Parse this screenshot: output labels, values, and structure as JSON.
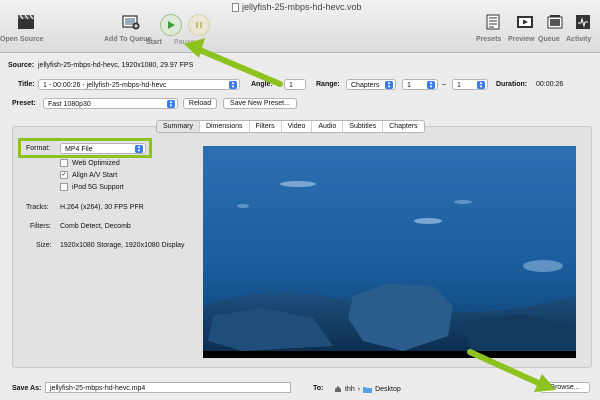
{
  "window": {
    "title": "jellyfish-25-mbps-hd-hevc.vob"
  },
  "toolbar": {
    "open_source": "Open Source",
    "add_to_queue": "Add To Queue",
    "start": "Start",
    "pause": "Pause",
    "presets": "Presets",
    "preview": "Preview",
    "queue": "Queue",
    "activity": "Activity"
  },
  "source": {
    "label": "Source:",
    "value": "jellyfish-25-mbps-hd-hevc, 1920x1080, 29.97 FPS"
  },
  "title_row": {
    "label": "Title:",
    "value": "1 - 00:00:26 - jellyfish-25-mbps-hd-hevc",
    "angle_label": "Angle:",
    "angle_value": "1",
    "range_label": "Range:",
    "range_type": "Chapters",
    "range_start": "1",
    "range_sep": "–",
    "range_end": "1",
    "duration_label": "Duration:",
    "duration_value": "00:00:26"
  },
  "preset_row": {
    "label": "Preset:",
    "value": "Fast 1080p30",
    "reload": "Reload",
    "save_new": "Save New Preset..."
  },
  "tabs": [
    "Summary",
    "Dimensions",
    "Filters",
    "Video",
    "Audio",
    "Subtitles",
    "Chapters"
  ],
  "summary": {
    "format_label": "Format:",
    "format_value": "MP4 File",
    "web_optimized": "Web Optimized",
    "align_av": "Align A/V Start",
    "ipod": "iPod 5G Support",
    "tracks_label": "Tracks:",
    "tracks_value": "H.264 (x264), 30 FPS PFR",
    "filters_label": "Filters:",
    "filters_value": "Comb Detect, Decomb",
    "size_label": "Size:",
    "size_value": "1920x1080 Storage, 1920x1080 Display"
  },
  "save": {
    "label": "Save As:",
    "value": "jellyfish-25-mbps-hd-hevc.mp4",
    "to_label": "To:",
    "path_user": "thh",
    "path_folder": "Desktop",
    "browse": "Browse..."
  },
  "colors": {
    "highlight": "#8dc21f",
    "accent": "#3b7ce8",
    "start_green": "#4caf50"
  }
}
